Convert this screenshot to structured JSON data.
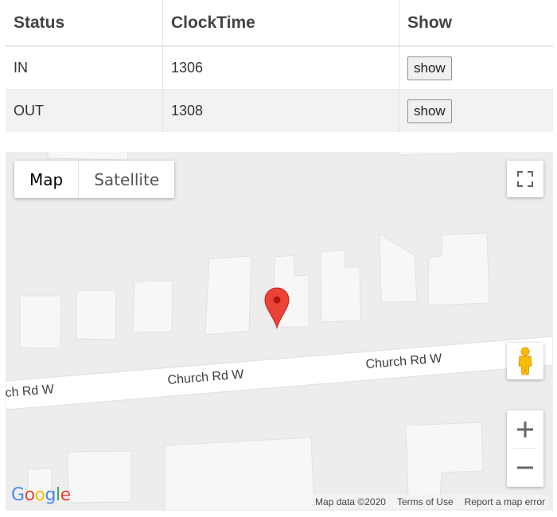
{
  "table": {
    "headers": [
      "Status",
      "ClockTime",
      "Show"
    ],
    "rows": [
      {
        "status": "IN",
        "clock_time": "1306",
        "show_label": "show"
      },
      {
        "status": "OUT",
        "clock_time": "1308",
        "show_label": "show"
      }
    ]
  },
  "map": {
    "type_control": {
      "map_label": "Map",
      "satellite_label": "Satellite",
      "selected": "Map"
    },
    "road_labels": [
      "ch Rd W",
      "Church Rd W",
      "Church Rd W"
    ],
    "logo": {
      "letters": [
        "G",
        "o",
        "o",
        "g",
        "l",
        "e"
      ],
      "colors": [
        "#4285F4",
        "#EA4335",
        "#FBBC05",
        "#4285F4",
        "#34A853",
        "#EA4335"
      ]
    },
    "attribution": {
      "map_data": "Map data ©2020",
      "terms": "Terms of Use",
      "report": "Report a map error"
    },
    "marker_color": "#EA4335",
    "icons": {
      "fullscreen": "fullscreen-icon",
      "pegman": "pegman-icon",
      "zoom_in": "plus-icon",
      "zoom_out": "minus-icon"
    }
  }
}
